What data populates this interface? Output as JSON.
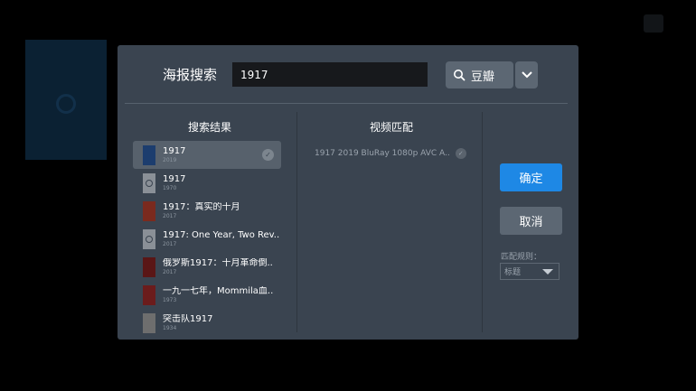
{
  "dialog": {
    "header_label": "海报搜索",
    "search": {
      "value": "1917"
    },
    "source_button": {
      "label": "豆瓣",
      "icon": "search-icon"
    },
    "source_dropdown_icon": "chevron-down-icon",
    "results_title": "搜索结果",
    "results": [
      {
        "title": "1917",
        "year": "2019",
        "selected": true,
        "thumb": "poster",
        "color": "#1c3d6e"
      },
      {
        "title": "1917",
        "year": "1970",
        "selected": false,
        "thumb": "placeholder"
      },
      {
        "title": "1917：真实的十月",
        "year": "2017",
        "selected": false,
        "thumb": "poster",
        "color": "#7a2a1e"
      },
      {
        "title": "1917: One Year, Two Rev..",
        "year": "2017",
        "selected": false,
        "thumb": "placeholder"
      },
      {
        "title": "俄罗斯1917：十月革命倒..",
        "year": "2017",
        "selected": false,
        "thumb": "poster",
        "color": "#5a1616"
      },
      {
        "title": "一九一七年，Mommila血..",
        "year": "1973",
        "selected": false,
        "thumb": "poster",
        "color": "#6b1c1c"
      },
      {
        "title": "突击队1917",
        "year": "1934",
        "selected": false,
        "thumb": "poster",
        "color": "#6e6e6e"
      }
    ],
    "match_title": "视频匹配",
    "match_item": "1917 2019 BluRay 1080p AVC A..",
    "confirm_label": "确定",
    "cancel_label": "取消",
    "rule_label": "匹配规则：",
    "rule_value": "标题"
  },
  "colors": {
    "accent": "#1e88e5",
    "dialog_bg": "#3a4450",
    "selected_bg": "#57616c"
  }
}
